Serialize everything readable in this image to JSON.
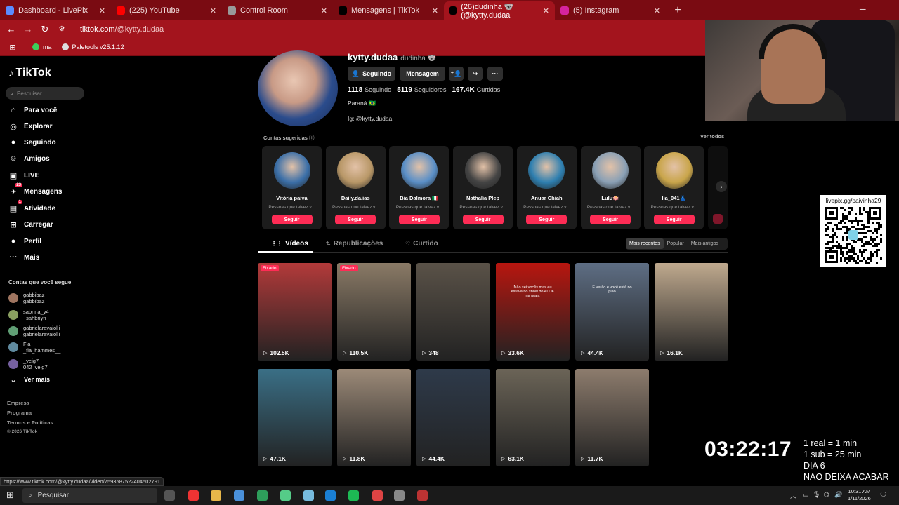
{
  "browser": {
    "tabs": [
      {
        "title": "Dashboard - LivePix",
        "icon": "livepix-icon",
        "color": "#5b8cff"
      },
      {
        "title": "(225) YouTube",
        "icon": "youtube-icon",
        "color": "#ff0000"
      },
      {
        "title": "Control Room",
        "icon": "globe-icon",
        "color": "#999999"
      },
      {
        "title": "Mensagens | TikTok",
        "icon": "tiktok-icon",
        "color": "#000000"
      },
      {
        "title": "(26)dudinha 🐨 (@kytty.dudaa",
        "icon": "tiktok-icon",
        "color": "#000000"
      },
      {
        "title": "(5) Instagram",
        "icon": "instagram-icon",
        "color": "#d6249f"
      }
    ],
    "active_tab": 4,
    "new_tab": "+",
    "url_host": "tiktok.com",
    "url_path": "/@kytty.dudaa",
    "bookmarks": [
      "ma",
      "Paletools v25.1.12"
    ],
    "status_url": "https://www.tiktok.com/@kytty.dudaa/video/7593587522404502791"
  },
  "sidebar": {
    "logo": "TikTok",
    "search_placeholder": "Pesquisar",
    "nav": [
      {
        "label": "Para você",
        "icon": "home-icon",
        "glyph": "⌂"
      },
      {
        "label": "Explorar",
        "icon": "compass-icon",
        "glyph": "◎"
      },
      {
        "label": "Seguindo",
        "icon": "following-avatar-icon",
        "glyph": "●"
      },
      {
        "label": "Amigos",
        "icon": "friends-icon",
        "glyph": "☺"
      },
      {
        "label": "LIVE",
        "icon": "live-icon",
        "glyph": "▣"
      },
      {
        "label": "Mensagens",
        "icon": "messages-icon",
        "glyph": "✈",
        "badge": "23"
      },
      {
        "label": "Atividade",
        "icon": "activity-icon",
        "glyph": "▤",
        "badge": "1"
      },
      {
        "label": "Carregar",
        "icon": "upload-icon",
        "glyph": "⊞"
      },
      {
        "label": "Perfil",
        "icon": "profile-icon",
        "glyph": "●"
      },
      {
        "label": "Mais",
        "icon": "more-icon",
        "glyph": "···"
      }
    ],
    "following_title": "Contas que você segue",
    "following": [
      {
        "name": "gabbibaz",
        "handle": "gabbibaz_"
      },
      {
        "name": "sabrina_y4",
        "handle": "_sahbriyn"
      },
      {
        "name": "gabrielaravaiolli",
        "handle": "gabrielaravaiolli"
      },
      {
        "name": "Fla",
        "handle": "_fla_hammes__"
      },
      {
        "name": "_veig7",
        "handle": "042_veig7"
      }
    ],
    "see_more": "Ver mais",
    "footer": [
      "Empresa",
      "Programa",
      "Termos e Políticas",
      "© 2026 TikTok"
    ]
  },
  "profile": {
    "username": "kytty.dudaa",
    "nickname": "dudinha 🐨",
    "buttons": {
      "following": "Seguindo",
      "message": "Mensagem",
      "more": "···"
    },
    "stats": [
      {
        "value": "1118",
        "label": "Seguindo"
      },
      {
        "value": "5119",
        "label": "Seguidores"
      },
      {
        "value": "167.4K",
        "label": "Curtidas"
      }
    ],
    "location": "Paraná 🇧🇷",
    "bio": "Ig: @kytty.dudaa"
  },
  "suggested": {
    "title": "Contas sugeridas",
    "see_all": "Ver todos",
    "subtitle": "Pessoas que talvez v...",
    "follow_label": "Seguir",
    "accounts": [
      {
        "name": "Vitória paiva",
        "color": "#3b6fa8"
      },
      {
        "name": "Daily.da.ias",
        "color": "#b89767"
      },
      {
        "name": "Bia Dalmora 🇮🇹",
        "color": "#5a8fc7"
      },
      {
        "name": "Nathalia Plep",
        "color": "#444444"
      },
      {
        "name": "Anuar Chiah",
        "color": "#2e7fb0"
      },
      {
        "name": "Lulu🪷",
        "color": "#8aa0b5"
      },
      {
        "name": "lia_041👗",
        "color": "#c9a54a"
      }
    ]
  },
  "content_tabs": [
    {
      "label": "Vídeos",
      "icon": "grid-icon",
      "glyph": "⋮⋮"
    },
    {
      "label": "Republicações",
      "icon": "repost-icon",
      "glyph": "⇅"
    },
    {
      "label": "Curtido",
      "icon": "heart-outline-icon",
      "glyph": "♡"
    }
  ],
  "sort": [
    "Mais recentes",
    "Popular",
    "Mais antigos"
  ],
  "videos": [
    {
      "views": "102.5K",
      "pinned": "Fixado",
      "color": "#b33a3a"
    },
    {
      "views": "110.5K",
      "pinned": "Fixado",
      "color": "#8a7a66"
    },
    {
      "views": "348",
      "color": "#5a5248"
    },
    {
      "views": "33.6K",
      "color": "#b8160f",
      "caption": "Não sei vocês mas eu estava no show do ALOK na praia"
    },
    {
      "views": "44.4K",
      "color": "#5e6e84",
      "caption": "E verão e você está no pião"
    },
    {
      "views": "16.1K",
      "color": "#bfa98e"
    },
    {
      "views": "47.1K",
      "color": "#3a6f86"
    },
    {
      "views": "11.8K",
      "color": "#9c8a78"
    },
    {
      "views": "44.4K",
      "color": "#2e3a4a"
    },
    {
      "views": "63.1K",
      "color": "#6b6457"
    },
    {
      "views": "11.7K",
      "color": "#8d7c6d"
    }
  ],
  "overlay": {
    "qr_label": "livepix.gg/paivinha29",
    "timer": "03:22:17",
    "notes": [
      "1 real = 1 min",
      "1 sub = 25 min",
      "DIA 6",
      "NAO DEIXA ACABAR"
    ]
  },
  "taskbar": {
    "search": "Pesquisar",
    "time": "10:31 AM",
    "date": "1/11/2026"
  }
}
